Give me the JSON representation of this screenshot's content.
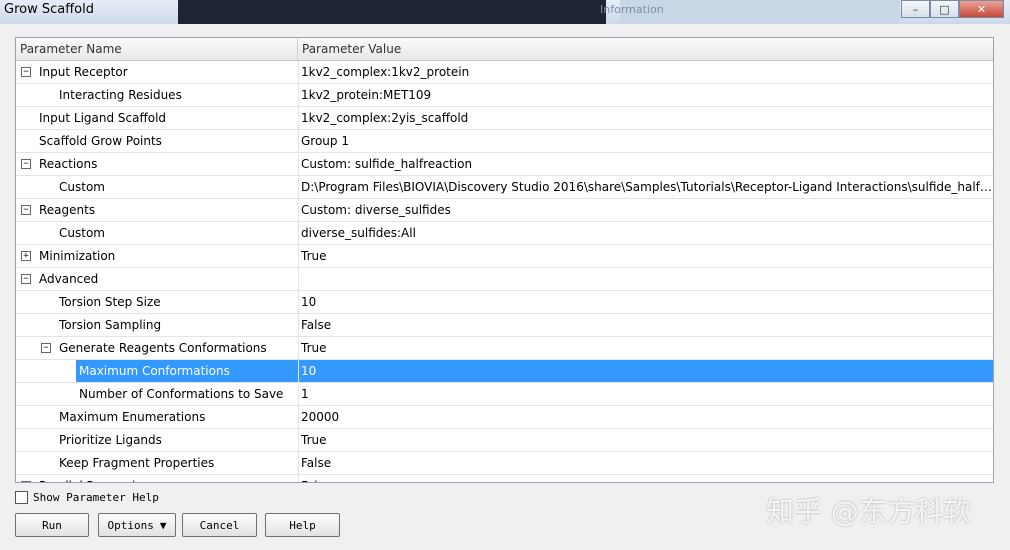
{
  "window": {
    "title": "Grow Scaffold",
    "bg_text": "Information"
  },
  "grid": {
    "col1": "Parameter Name",
    "col2": "Parameter Value",
    "rows": [
      {
        "name": "Input Receptor",
        "value": "1kv2_complex:1kv2_protein",
        "level": 0,
        "toggle": "−"
      },
      {
        "name": "Interacting Residues",
        "value": "1kv2_protein:MET109",
        "level": 1,
        "toggle": ""
      },
      {
        "name": "Input Ligand Scaffold",
        "value": "1kv2_complex:2yis_scaffold",
        "level": 0,
        "toggle": ""
      },
      {
        "name": "Scaffold Grow Points",
        "value": "Group 1",
        "level": 0,
        "toggle": ""
      },
      {
        "name": "Reactions",
        "value": "Custom: sulfide_halfreaction",
        "level": 0,
        "toggle": "−"
      },
      {
        "name": "Custom",
        "value": "D:\\Program Files\\BIOVIA\\Discovery Studio 2016\\share\\Samples\\Tutorials\\Receptor-Ligand Interactions\\sulfide_halfreaction",
        "level": 1,
        "toggle": ""
      },
      {
        "name": "Reagents",
        "value": "Custom: diverse_sulfides",
        "level": 0,
        "toggle": "−"
      },
      {
        "name": "Custom",
        "value": "diverse_sulfides:All",
        "level": 1,
        "toggle": ""
      },
      {
        "name": "Minimization",
        "value": "True",
        "level": 0,
        "toggle": "+"
      },
      {
        "name": "Advanced",
        "value": "",
        "level": 0,
        "toggle": "−"
      },
      {
        "name": "Torsion Step Size",
        "value": "10",
        "level": 1,
        "toggle": ""
      },
      {
        "name": "Torsion Sampling",
        "value": "False",
        "level": 1,
        "toggle": ""
      },
      {
        "name": "Generate Reagents Conformations",
        "value": "True",
        "level": 1,
        "toggle": "−"
      },
      {
        "name": "Maximum Conformations",
        "value": "10",
        "level": 2,
        "toggle": "",
        "selected": true
      },
      {
        "name": "Number of Conformations to Save",
        "value": "1",
        "level": 2,
        "toggle": ""
      },
      {
        "name": "Maximum Enumerations",
        "value": "20000",
        "level": 1,
        "toggle": ""
      },
      {
        "name": "Prioritize Ligands",
        "value": "True",
        "level": 1,
        "toggle": ""
      },
      {
        "name": "Keep Fragment Properties",
        "value": "False",
        "level": 1,
        "toggle": ""
      },
      {
        "name": "Parallel Processing",
        "value": "False",
        "level": 0,
        "toggle": "+"
      }
    ]
  },
  "footer": {
    "show_help": "Show Parameter Help",
    "run": "Run",
    "options": "Options",
    "cancel": "Cancel",
    "help": "Help"
  },
  "watermark": "知乎 @东方科软",
  "colors": {
    "selection": "#3399ff"
  }
}
